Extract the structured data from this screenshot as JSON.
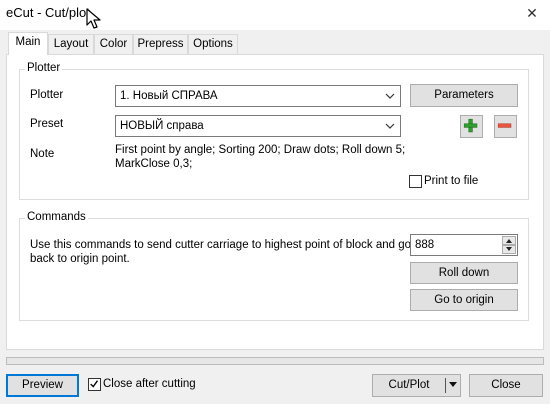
{
  "window": {
    "title": "eCut - Cut/plot",
    "close_glyph": "✕"
  },
  "tabs": [
    {
      "label": "Main",
      "active": true
    },
    {
      "label": "Layout"
    },
    {
      "label": "Color"
    },
    {
      "label": "Prepress"
    },
    {
      "label": "Options"
    }
  ],
  "plotter_group": {
    "title": "Plotter",
    "plotter_label": "Plotter",
    "plotter_value": "1. Новый СПРАВА",
    "parameters_button": "Parameters",
    "preset_label": "Preset",
    "preset_value": "НОВЫЙ справа",
    "note_label": "Note",
    "note_line1": "First point by angle; Sorting 200; Draw dots; Roll down 5;",
    "note_line2": "MarkClose 0,3;",
    "print_to_file_label": "Print to file",
    "print_to_file_checked": false,
    "add_icon": "plus-icon",
    "remove_icon": "minus-icon",
    "add_color": "#2f9e2f",
    "remove_color": "#e8563f"
  },
  "commands_group": {
    "title": "Commands",
    "desc_line1": "Use this commands to send cutter carriage to highest point of block and go",
    "desc_line2": "back to origin point.",
    "amount_value": "888",
    "roll_down_button": "Roll down",
    "go_to_origin_button": "Go to origin"
  },
  "footer": {
    "preview_button": "Preview",
    "close_after_cutting_label": "Close after cutting",
    "close_after_cutting_checked": true,
    "cut_plot_button": "Cut/Plot",
    "close_button": "Close"
  },
  "colors": {
    "focus_border": "#0078d7",
    "button_bg": "#e1e1e1",
    "panel_bg": "#ffffff"
  }
}
